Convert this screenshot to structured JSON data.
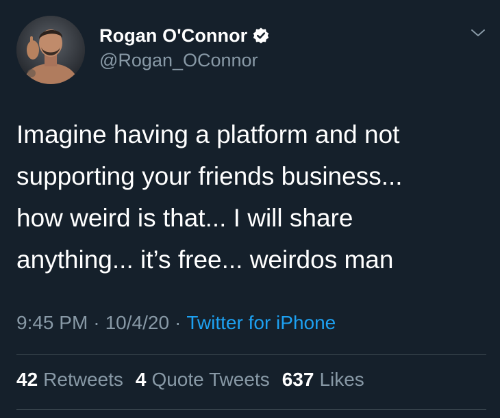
{
  "author": {
    "display_name": "Rogan O'Connor",
    "handle": "@Rogan_OConnor",
    "verified": true,
    "avatar_icon": "profile-photo"
  },
  "tweet": {
    "text": "Imagine having a platform and not\nsupporting your friends business...\nhow weird is that... I will share\nanything... it’s free... weirdos man"
  },
  "meta": {
    "time": "9:45 PM",
    "separator": "·",
    "date": "10/4/20",
    "source": "Twitter for iPhone"
  },
  "stats": {
    "retweets_count": "42",
    "retweets_label": "Retweets",
    "quotes_count": "4",
    "quotes_label": "Quote Tweets",
    "likes_count": "637",
    "likes_label": "Likes"
  },
  "colors": {
    "background": "#15202b",
    "primary_text": "#ffffff",
    "secondary_text": "#8899a6",
    "link": "#1da1f2",
    "divider": "#38444d"
  }
}
